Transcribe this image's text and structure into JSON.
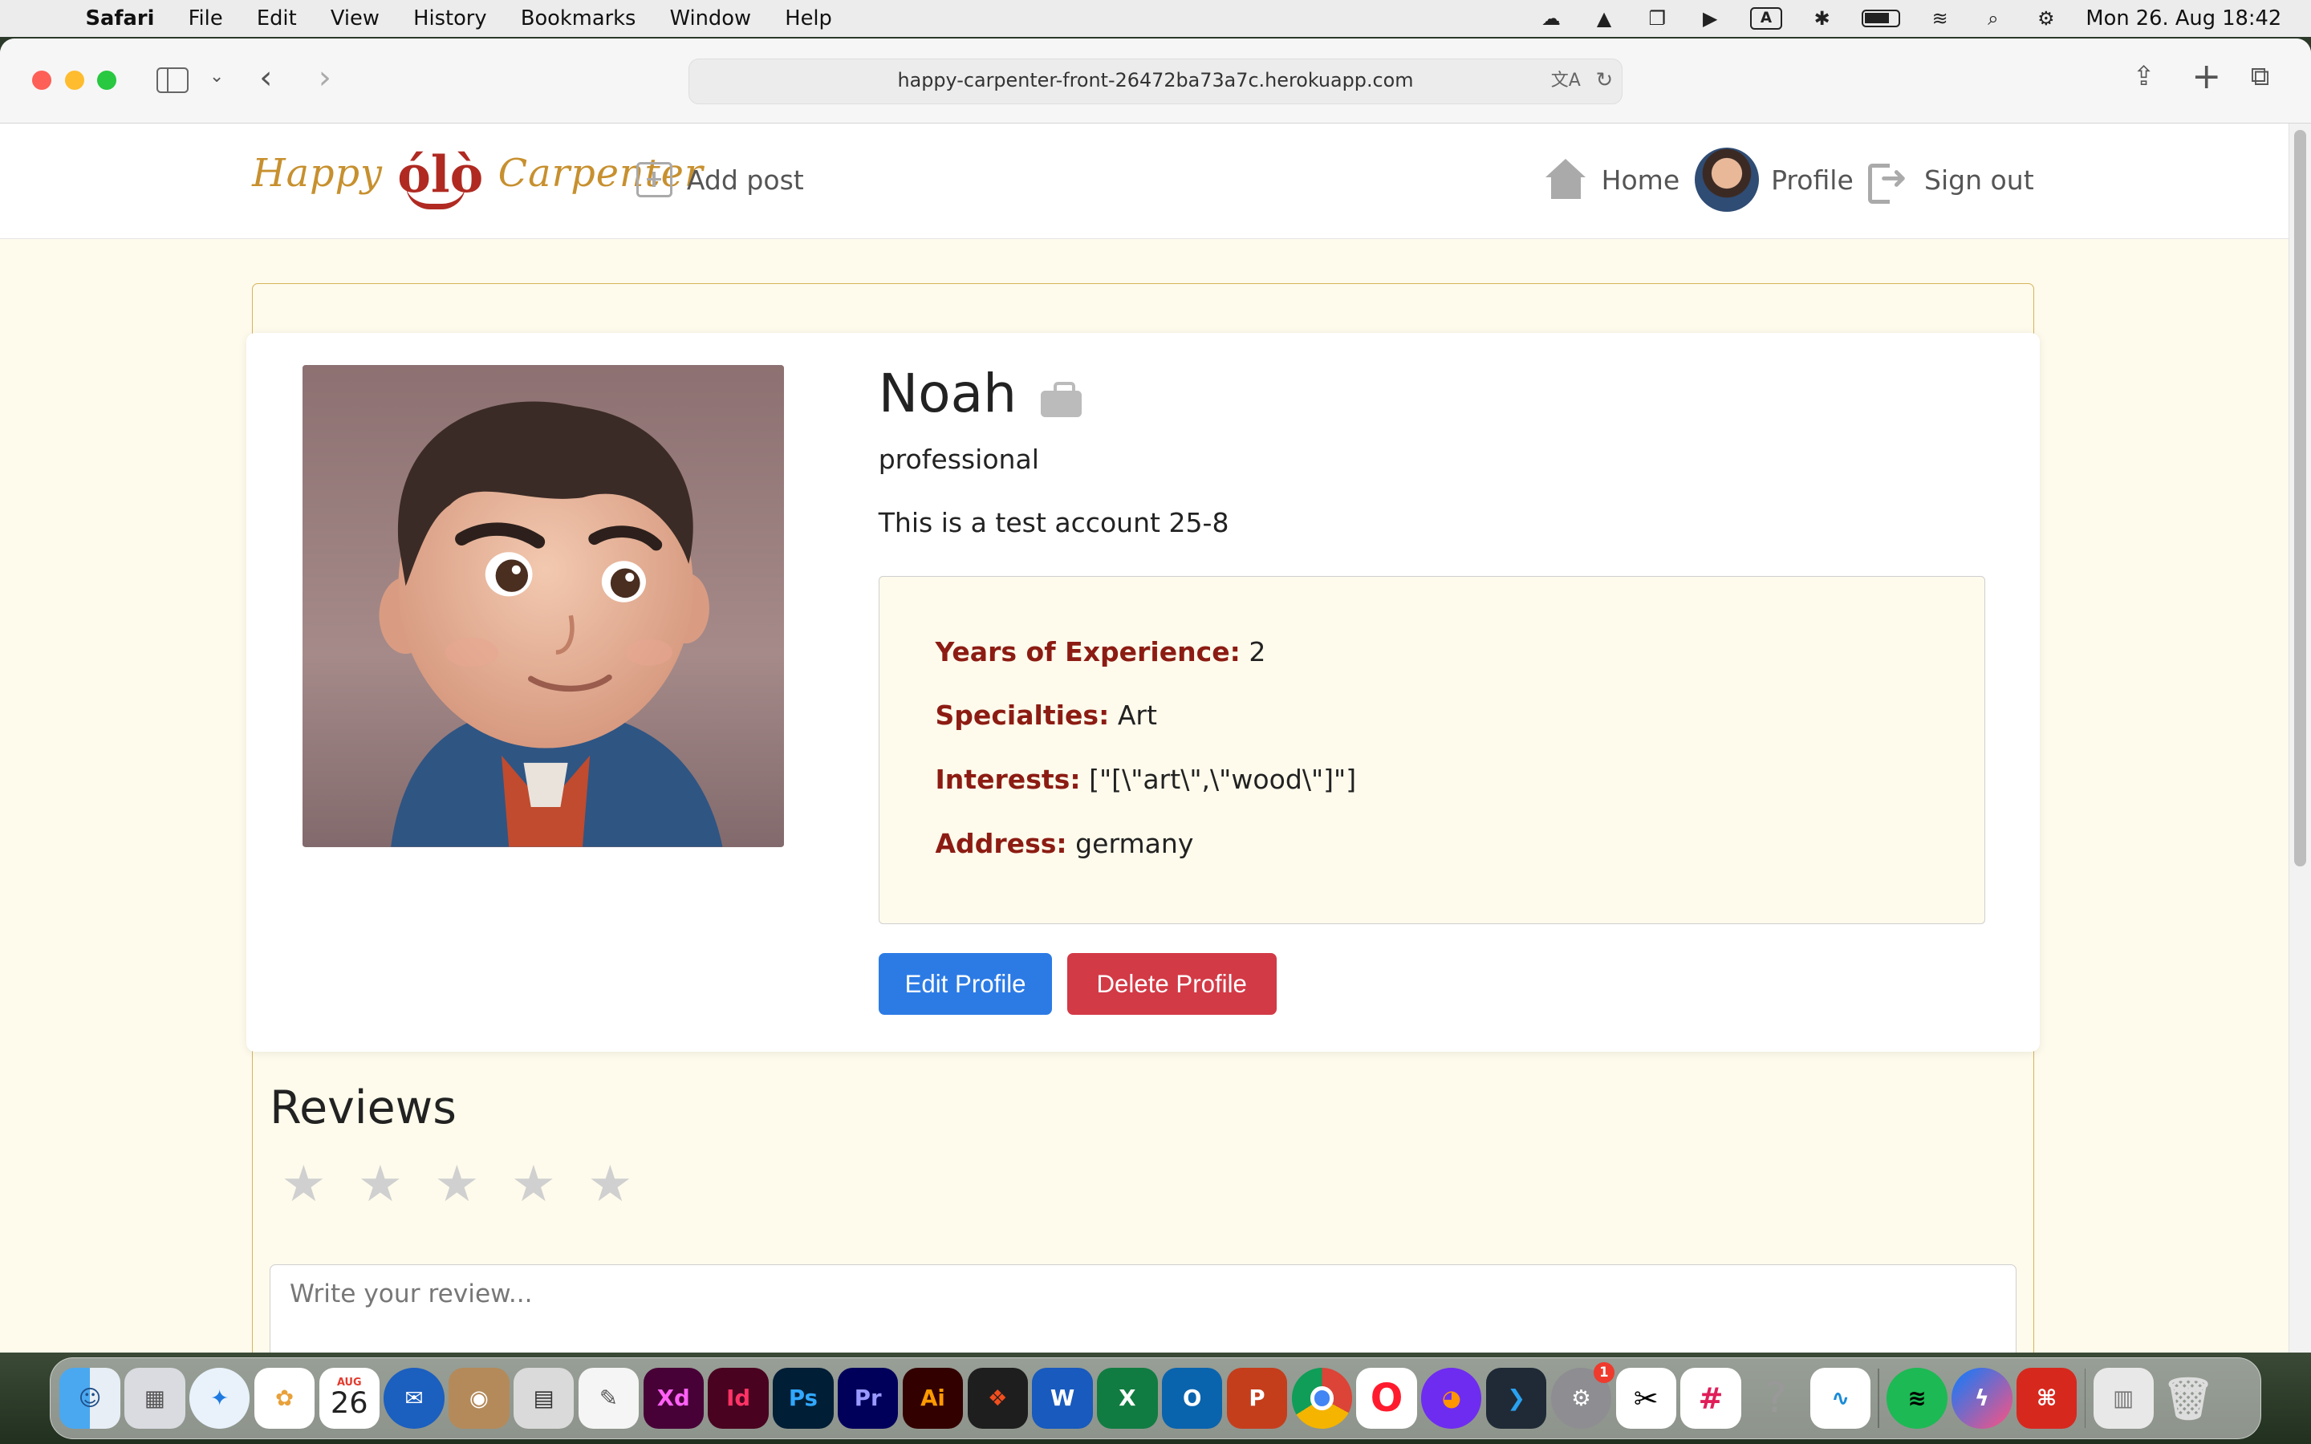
{
  "menubar": {
    "app_name": "Safari",
    "items": [
      "File",
      "Edit",
      "View",
      "History",
      "Bookmarks",
      "Window",
      "Help"
    ],
    "clock": "Mon 26. Aug  18:42",
    "keyboard_indicator": "A"
  },
  "browser": {
    "url": "happy-carpenter-front-26472ba73a7c.herokuapp.com"
  },
  "navbar": {
    "logo_left": "Happy",
    "logo_mid": "ólò",
    "logo_right": "Carpenter",
    "add_post": "Add post",
    "home": "Home",
    "profile": "Profile",
    "sign_out": "Sign out"
  },
  "profile": {
    "name": "Noah",
    "role": "professional",
    "bio": "This is a test account 25-8",
    "details": [
      {
        "label": "Years of Experience:",
        "value": "2"
      },
      {
        "label": "Specialties:",
        "value": "Art"
      },
      {
        "label": "Interests:",
        "value": "[\"[\\\"art\\\",\\\"wood\\\"]\"]"
      },
      {
        "label": "Address:",
        "value": "germany"
      }
    ],
    "edit_button": "Edit Profile",
    "delete_button": "Delete Profile"
  },
  "reviews": {
    "title": "Reviews",
    "rating": 0,
    "max_rating": 5,
    "placeholder": "Write your review..."
  },
  "dock": {
    "calendar_month": "AUG",
    "calendar_day": "26",
    "apps": [
      "Finder",
      "Launchpad",
      "Safari",
      "Photos",
      "Calendar",
      "Thunderbird",
      "Contacts",
      "Calculator",
      "TextEdit",
      "Xd",
      "Id",
      "Ps",
      "Pr",
      "Ai",
      "Figma",
      "Word",
      "Excel",
      "Outlook",
      "PowerPoint",
      "Chrome",
      "Opera",
      "Firefox",
      "VS Code",
      "System Settings",
      "CapCut",
      "Slack",
      "Help",
      "Freeform",
      "Spotify",
      "Messenger",
      "Acrobat",
      "Documents",
      "Trash"
    ],
    "settings_badge": "1"
  },
  "colors": {
    "page_bg": "#fefbec",
    "accent_gold": "#c7902f",
    "label_red": "#8c1c13",
    "edit_blue": "#2c7be5",
    "delete_red": "#d23a46"
  }
}
